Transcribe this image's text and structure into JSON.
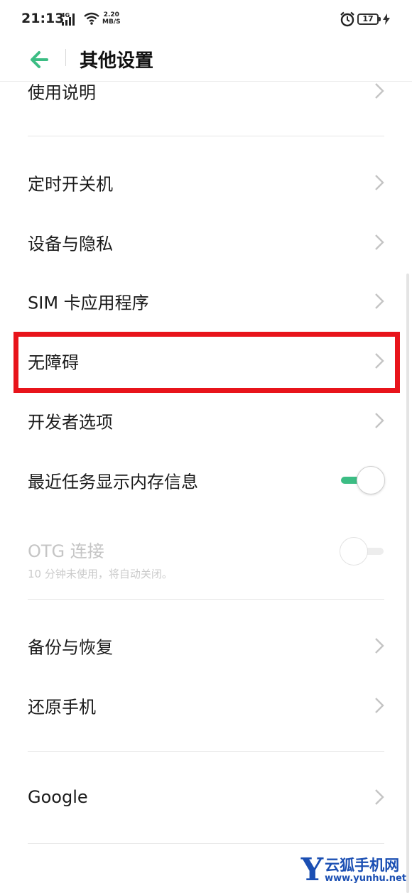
{
  "status_bar": {
    "time": "21:13",
    "network": "4G",
    "speed_value": "2.20",
    "speed_unit": "MB/S",
    "battery": "17"
  },
  "header": {
    "title": "其他设置"
  },
  "items": {
    "instructions": "使用说明",
    "scheduled_power": "定时开关机",
    "device_privacy": "设备与隐私",
    "sim_apps": "SIM 卡应用程序",
    "accessibility": "无障碍",
    "developer_options": "开发者选项",
    "recent_tasks_memory": "最近任务显示内存信息",
    "otg": "OTG 连接",
    "otg_sub": "10 分钟未使用，将自动关闭。",
    "backup_restore": "备份与恢复",
    "reset_phone": "还原手机",
    "google": "Google"
  },
  "toggles": {
    "recent_tasks_memory": true,
    "otg": false
  },
  "colors": {
    "accent": "#3cbd84",
    "highlight": "#e8141b"
  },
  "watermark": {
    "logo_letter": "Y",
    "name": "云狐手机网",
    "url": "www.yunhu.net"
  }
}
